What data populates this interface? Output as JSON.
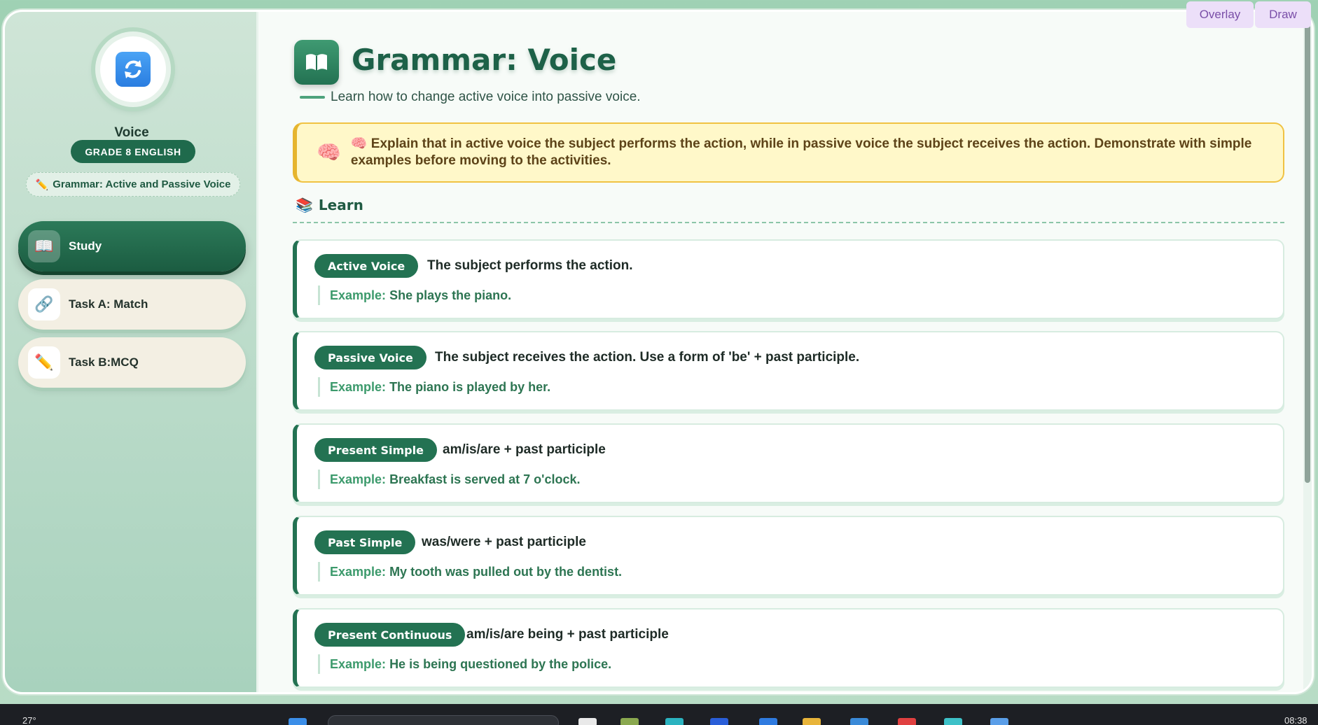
{
  "sidebar": {
    "title": "Voice",
    "grade": "GRADE 8 ENGLISH",
    "topic": "Grammar: Active and Passive Voice",
    "nav": [
      {
        "label": "Study",
        "icon": "book-icon",
        "active": true
      },
      {
        "label": "Task A: Match",
        "icon": "link-icon",
        "active": false
      },
      {
        "label": "Task B:MCQ",
        "icon": "pencil-icon",
        "active": false
      }
    ]
  },
  "header": {
    "title": "Grammar: Voice",
    "subtitle": "Learn how to change active voice into passive voice."
  },
  "teacher_note": {
    "icon": "brain-icon",
    "text": "🧠 Explain that in active voice the subject performs the action, while in passive voice the subject receives the action. Demonstrate with simple examples before moving to the activities."
  },
  "learn": {
    "heading": "Learn",
    "example_label": "Example:",
    "cards": [
      {
        "term": "Active Voice",
        "definition": "The subject performs the action.",
        "example": "She plays the piano."
      },
      {
        "term": "Passive Voice",
        "definition": "The subject receives the action. Use a form of 'be' + past participle.",
        "example": "The piano is played by her."
      },
      {
        "term": "Present Simple",
        "definition": "am/is/are + past participle",
        "example": "Breakfast is served at 7 o'clock."
      },
      {
        "term": "Past Simple",
        "definition": "was/were + past participle",
        "example": "My tooth was pulled out by the dentist."
      },
      {
        "term": "Present Continuous",
        "definition": "am/is/are being + past participle",
        "example": "He is being questioned by the police."
      }
    ]
  },
  "toolbar": {
    "overlay_label": "Overlay",
    "draw_label": "Draw"
  },
  "taskbar": {
    "temperature": "27°",
    "time": "08:38"
  },
  "colors": {
    "primary": "#237252",
    "note_bg": "#fff8c9",
    "note_border": "#f0c243",
    "sidebar_bg": "#b8dcc8"
  }
}
